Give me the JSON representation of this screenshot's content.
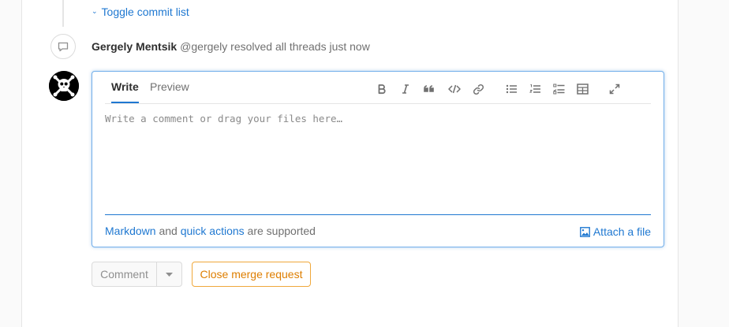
{
  "timeline": {
    "toggle_label": "Toggle commit list",
    "note": {
      "author": "Gergely Mentsik",
      "text": "@gergely resolved all threads just now"
    }
  },
  "editor": {
    "tabs": [
      "Write",
      "Preview"
    ],
    "toolbar_icons": [
      "bold-icon",
      "italic-icon",
      "quote-icon",
      "code-icon",
      "link-icon",
      "bullet-list-icon",
      "numbered-list-icon",
      "task-list-icon",
      "table-icon",
      "fullscreen-icon"
    ],
    "placeholder": "Write a comment or drag your files here…",
    "footer": {
      "markdown_link": "Markdown",
      "and": " and ",
      "quick_actions_link": "quick actions",
      "suffix": " are supported"
    },
    "attach_label": "Attach a file"
  },
  "actions": {
    "comment_label": "Comment",
    "close_label": "Close merge request"
  },
  "colors": {
    "link": "#1f78d1",
    "close_button": "#de7e00"
  }
}
